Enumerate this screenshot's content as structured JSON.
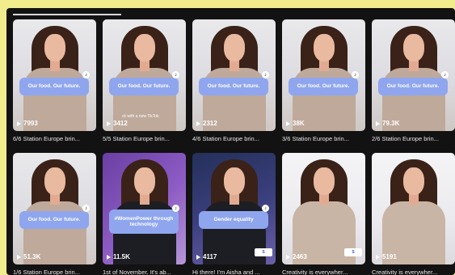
{
  "grid": {
    "row1": [
      {
        "views": "7993",
        "title": "6/6 Station Europe brin...",
        "caption": "Our food. Our future.",
        "overlay": "",
        "logo": "",
        "bg": "default",
        "outfit": "default"
      },
      {
        "views": "3412",
        "title": "5/5 Station Europe brin...",
        "caption": "Our food. Our future.",
        "overlay": "ck with a new TikTok",
        "logo": "",
        "bg": "default",
        "outfit": "default"
      },
      {
        "views": "2312",
        "title": "4/6 Station Europe brin...",
        "caption": "Our food. Our future.",
        "overlay": "",
        "logo": "",
        "bg": "default",
        "outfit": "default"
      },
      {
        "views": "38K",
        "title": "3/6 Station Europe brin...",
        "caption": "Our food. Our future.",
        "overlay": "",
        "logo": "",
        "bg": "default",
        "outfit": "default"
      },
      {
        "views": "79.3K",
        "title": "2/6 Station Europe brin...",
        "caption": "Our food. Our future.",
        "overlay": "",
        "logo": "",
        "bg": "default",
        "outfit": "default"
      }
    ],
    "row2": [
      {
        "views": "51.3K",
        "title": "1/6 Station Europe brin...",
        "caption": "Our food. Our future.",
        "overlay": "",
        "logo": "",
        "bg": "default",
        "outfit": "default"
      },
      {
        "views": "11.5K",
        "title": "1st of November. It's ab...",
        "caption": "#WomenPower through technology",
        "overlay": "",
        "logo": "",
        "bg": "purple",
        "outfit": "dark"
      },
      {
        "views": "4117",
        "title": "Hi there! I'm Aisha and ...",
        "caption": "Gender equality",
        "overlay": "",
        "logo": "S",
        "bg": "blue",
        "outfit": "dark"
      },
      {
        "views": "2463",
        "title": "Creativity is everywher...",
        "caption": "",
        "overlay": "",
        "logo": "S",
        "bg": "white",
        "outfit": "light"
      },
      {
        "views": "5191",
        "title": "Creativity is everywher...",
        "caption": "",
        "overlay": "",
        "logo": "",
        "bg": "white",
        "outfit": "light"
      }
    ]
  },
  "colors": {
    "page_bg": "#f1ec8c",
    "app_bg": "#121212",
    "caption_pill": "#8fa6ee"
  }
}
